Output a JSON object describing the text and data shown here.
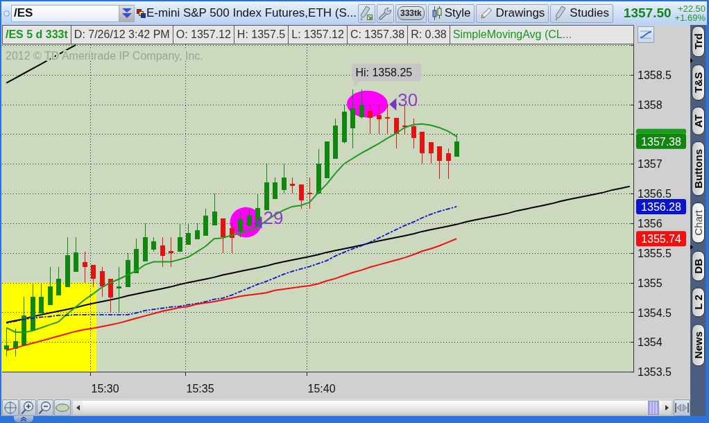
{
  "toolbar": {
    "symbol": "/ES",
    "description": "E-mini S&P 500 Index Futures,ETH (S...",
    "buttons": [
      {
        "kind": "pill",
        "label": "333tk"
      },
      {
        "kind": "candles",
        "label": "Style"
      },
      {
        "kind": "pencil",
        "label": "Drawings"
      },
      {
        "kind": "flask",
        "label": "Studies"
      }
    ],
    "last_price": "1357.50",
    "net_change": "+22.50",
    "percent_change": "+1.69%"
  },
  "info_bar": {
    "symbol": "/ES 5 d 333t",
    "fields": [
      "D: 7/26/12 3:42 PM",
      "O: 1357.12",
      "H: 1357.5",
      "L: 1357.12",
      "C: 1357.38",
      "R: 0.38"
    ],
    "study": "SimpleMovingAvg (CL..."
  },
  "chart": {
    "copyright": "2012 © TD Ameritrade IP Company, Inc.",
    "high_label": "Hi: 1358.25",
    "close_tag": "1357.38",
    "price_tags": [
      {
        "color": "#1e9a1e"
      },
      {
        "text": "1356.28",
        "color": "#0a14cc"
      },
      {
        "text": "1355.74",
        "color": "#f01010"
      }
    ],
    "chart_data": {
      "type": "candlestick",
      "categories": [
        null,
        null,
        null,
        null,
        null,
        null,
        null,
        null,
        null,
        null,
        null,
        "15:30",
        null,
        null,
        null,
        null,
        null,
        null,
        null,
        null,
        null,
        null,
        "15:35",
        null,
        null,
        null,
        null,
        null,
        null,
        null,
        null,
        null,
        null,
        null,
        null,
        null,
        "15:40",
        null,
        null,
        null,
        null,
        null,
        null,
        null,
        null,
        null,
        null,
        null,
        null,
        null,
        null,
        null,
        null,
        null,
        null,
        null,
        null,
        null,
        null,
        null,
        null,
        null,
        null,
        null,
        null,
        null,
        null,
        null,
        null,
        null,
        null,
        null,
        null
      ],
      "ohlc": [
        [
          1353.87,
          1354.24,
          1353.76,
          1353.94
        ],
        [
          1353.89,
          1354.22,
          1353.76,
          1354.02
        ],
        [
          1353.95,
          1354.76,
          1353.95,
          1354.45
        ],
        [
          1354.19,
          1355.0,
          1354.19,
          1354.76
        ],
        [
          1354.48,
          1355.0,
          1354.48,
          1354.76
        ],
        [
          1354.62,
          1355.26,
          1354.62,
          1354.94
        ],
        [
          1354.78,
          1355.26,
          1354.78,
          1355.07
        ],
        [
          1354.93,
          1355.76,
          1354.93,
          1355.46
        ],
        [
          1355.18,
          1355.76,
          1355.18,
          1355.51
        ],
        [
          1355.35,
          1355.52,
          1355.0,
          1355.26
        ],
        [
          1355.3,
          1355.3,
          1354.92,
          1355.07
        ],
        [
          1355.19,
          1355.26,
          1354.76,
          1354.94
        ],
        [
          1355.06,
          1355.07,
          1354.5,
          1354.75
        ],
        [
          1354.9,
          1355.26,
          1354.5,
          1354.94
        ],
        [
          1354.93,
          1355.5,
          1354.93,
          1355.38
        ],
        [
          1355.16,
          1355.74,
          1355.16,
          1355.57
        ],
        [
          1355.36,
          1356.0,
          1355.36,
          1355.76
        ],
        [
          1355.55,
          1355.76,
          1355.52,
          1355.69
        ],
        [
          1355.62,
          1355.76,
          1355.26,
          1355.45
        ],
        [
          1355.53,
          1355.76,
          1355.26,
          1355.5
        ],
        [
          1355.52,
          1356.0,
          1355.52,
          1355.76
        ],
        [
          1355.64,
          1356.0,
          1355.64,
          1355.83
        ],
        [
          1355.73,
          1356.0,
          1355.73,
          1355.88
        ],
        [
          1355.79,
          1356.25,
          1355.79,
          1356.13
        ],
        [
          1355.96,
          1356.5,
          1355.96,
          1356.2
        ],
        [
          1356.08,
          1356.08,
          1355.5,
          1355.76
        ],
        [
          1355.92,
          1356.0,
          1355.5,
          1355.75
        ],
        [
          1355.86,
          1356.19,
          1355.76,
          1356.07
        ],
        [
          1355.95,
          1356.25,
          1355.95,
          1356.13
        ],
        [
          1355.94,
          1356.5,
          1355.94,
          1356.26
        ],
        [
          1356.22,
          1357.0,
          1356.22,
          1356.69
        ],
        [
          1356.41,
          1356.77,
          1356.41,
          1356.69
        ],
        [
          1356.56,
          1357.0,
          1356.5,
          1356.77
        ],
        [
          1356.66,
          1356.77,
          1356.5,
          1356.63
        ],
        [
          1356.65,
          1356.65,
          1356.25,
          1356.38
        ],
        [
          1356.51,
          1356.77,
          1356.25,
          1356.49
        ],
        [
          1356.5,
          1357.25,
          1356.5,
          1357.0
        ],
        [
          1356.76,
          1357.38,
          1356.76,
          1357.38
        ],
        [
          1357.08,
          1357.76,
          1357.08,
          1357.64
        ],
        [
          1357.37,
          1358.0,
          1357.34,
          1357.88
        ],
        [
          1357.6,
          1358.25,
          1357.26,
          1357.94
        ],
        [
          1357.78,
          1358.25,
          1357.76,
          1358.0
        ],
        [
          1357.89,
          1358.0,
          1357.5,
          1357.77
        ],
        [
          1357.82,
          1358.0,
          1357.5,
          1357.75
        ],
        [
          1357.78,
          1358.0,
          1357.5,
          1357.76
        ],
        [
          1357.77,
          1357.77,
          1357.26,
          1357.5
        ],
        [
          1357.65,
          1358.0,
          1357.5,
          1357.63
        ],
        [
          1357.63,
          1357.76,
          1357.26,
          1357.44
        ],
        [
          1357.54,
          1357.54,
          1357.0,
          1357.18
        ],
        [
          1357.37,
          1357.37,
          1357.0,
          1357.18
        ],
        [
          1357.29,
          1357.29,
          1356.75,
          1357.05
        ],
        [
          1357.18,
          1357.26,
          1356.75,
          1357.05
        ],
        [
          1357.12,
          1357.5,
          1357.12,
          1357.38
        ],
        null,
        null,
        null,
        null,
        null,
        null,
        null,
        null,
        null,
        null,
        null,
        null,
        null,
        null,
        null,
        null,
        null,
        null,
        null,
        null
      ],
      "series": [
        {
          "type": "line",
          "color": "#1e9a1e",
          "values": [
            1354.24,
            1354.17,
            1354.16,
            1354.19,
            1354.24,
            1354.29,
            1354.34,
            1354.47,
            1354.59,
            1354.71,
            1354.81,
            1354.92,
            1355.0,
            1355.06,
            1355.13,
            1355.2,
            1355.3,
            1355.35,
            1355.35,
            1355.35,
            1355.39,
            1355.43,
            1355.52,
            1355.61,
            1355.74,
            1355.75,
            1355.8,
            1355.83,
            1355.88,
            1355.93,
            1356.04,
            1356.14,
            1356.22,
            1356.28,
            1356.3,
            1356.35,
            1356.51,
            1356.66,
            1356.84,
            1357.0,
            1357.09,
            1357.18,
            1357.26,
            1357.34,
            1357.43,
            1357.51,
            1357.61,
            1357.66,
            1357.67,
            1357.65,
            1357.61,
            1357.55,
            1357.46,
            null,
            null,
            null,
            null,
            null,
            null,
            null,
            null,
            null,
            null,
            null,
            null,
            null,
            null,
            null,
            null,
            null,
            null,
            null,
            null
          ]
        },
        {
          "type": "line",
          "color": "#0a14cc",
          "line_style": "dashed",
          "values": [
            1354.32,
            1354.35,
            1354.38,
            1354.4,
            1354.42,
            1354.43,
            1354.45,
            1354.45,
            1354.46,
            1354.46,
            1354.46,
            1354.46,
            1354.46,
            1354.46,
            1354.46,
            1354.49,
            1354.53,
            1354.55,
            1354.57,
            1354.59,
            1354.6,
            1354.63,
            1354.65,
            1354.68,
            1354.72,
            1354.74,
            1354.79,
            1354.85,
            1354.91,
            1354.97,
            1355.02,
            1355.08,
            1355.14,
            1355.19,
            1355.23,
            1355.27,
            1355.32,
            1355.37,
            1355.45,
            1355.51,
            1355.57,
            1355.62,
            1355.68,
            1355.75,
            1355.82,
            1355.89,
            1355.96,
            1356.02,
            1356.09,
            1356.15,
            1356.2,
            1356.24,
            1356.28,
            null,
            null,
            null,
            null,
            null,
            null,
            null,
            null,
            null,
            null,
            null,
            null,
            null,
            null,
            null,
            null,
            null,
            null,
            null,
            null
          ]
        },
        {
          "type": "line",
          "color": "#f01010",
          "values": [
            1353.86,
            1353.9,
            1353.94,
            1353.98,
            1354.02,
            1354.06,
            1354.1,
            1354.14,
            1354.18,
            1354.21,
            1354.23,
            1354.26,
            1354.29,
            1354.32,
            1354.36,
            1354.4,
            1354.44,
            1354.48,
            1354.52,
            1354.55,
            1354.58,
            1354.6,
            1354.64,
            1354.66,
            1354.68,
            1354.71,
            1354.74,
            1354.77,
            1354.79,
            1354.81,
            1354.83,
            1354.87,
            1354.89,
            1354.91,
            1354.93,
            1354.95,
            1354.98,
            1355.03,
            1355.07,
            1355.12,
            1355.17,
            1355.21,
            1355.26,
            1355.3,
            1355.34,
            1355.38,
            1355.42,
            1355.47,
            1355.53,
            1355.57,
            1355.62,
            1355.68,
            1355.74,
            null,
            null,
            null,
            null,
            null,
            null,
            null,
            null,
            null,
            null,
            null,
            null,
            null,
            null,
            null,
            null,
            null,
            null,
            null,
            null
          ]
        },
        {
          "type": "line",
          "color": "#000000",
          "values": [
            1354.33,
            1354.36,
            1354.39,
            1354.43,
            1354.46,
            1354.49,
            1354.52,
            1354.55,
            1354.58,
            1354.62,
            1354.65,
            1354.68,
            1354.71,
            1354.74,
            1354.78,
            1354.81,
            1354.84,
            1354.87,
            1354.9,
            1354.93,
            1354.97,
            1355.0,
            1355.03,
            1355.06,
            1355.09,
            1355.13,
            1355.16,
            1355.19,
            1355.22,
            1355.25,
            1355.28,
            1355.32,
            1355.35,
            1355.38,
            1355.41,
            1355.44,
            1355.47,
            1355.51,
            1355.54,
            1355.57,
            1355.6,
            1355.63,
            1355.67,
            1355.7,
            1355.73,
            1355.76,
            1355.79,
            1355.82,
            1355.86,
            1355.89,
            1355.92,
            1355.95,
            1355.98,
            1356.02,
            1356.05,
            1356.08,
            1356.11,
            1356.14,
            1356.17,
            1356.21,
            1356.24,
            1356.27,
            1356.3,
            1356.33,
            1356.37,
            1356.4,
            1356.43,
            1356.46,
            1356.49,
            1356.52,
            1356.56,
            1356.59,
            1356.62
          ]
        },
        {
          "type": "line",
          "color": "#000000",
          "values": [
            1358.36,
            1358.44,
            1358.52,
            1358.6,
            1358.68,
            1358.76,
            1358.84,
            1358.92,
            1359.0,
            null,
            null,
            null,
            null,
            null,
            null,
            null,
            null,
            null,
            null,
            null,
            null,
            null,
            null,
            null,
            null,
            null,
            null,
            null,
            null,
            null,
            null,
            null,
            null,
            null,
            null,
            null,
            null,
            null,
            null,
            null,
            null,
            null,
            null,
            null,
            null,
            null,
            null,
            null,
            null,
            null,
            null,
            null,
            null,
            null,
            null,
            null,
            null,
            null,
            null,
            null,
            null,
            null,
            null,
            null,
            null,
            null,
            null,
            null,
            null,
            null,
            null,
            null,
            null
          ]
        }
      ],
      "ylim": [
        1353.49,
        1359.01
      ],
      "yticks": [
        1353.5,
        1354,
        1354.5,
        1355,
        1355.5,
        1356,
        1356.5,
        1357,
        1358,
        1358.5
      ],
      "grid": true,
      "annotations": [
        "29",
        "30"
      ]
    }
  },
  "side_tab_groups": [
    {
      "tabs": [
        {
          "label": "Trd",
          "selected": false
        }
      ]
    },
    {
      "tabs": [
        {
          "label": "T&S",
          "selected": false
        },
        {
          "label": "AT",
          "selected": false
        },
        {
          "label": "Buttons",
          "selected": false
        },
        {
          "label": "Chart",
          "selected": true
        }
      ]
    },
    {
      "tabs": [
        {
          "label": "DB",
          "selected": false
        },
        {
          "label": "L 2",
          "selected": false
        },
        {
          "label": "News",
          "selected": false
        }
      ]
    }
  ]
}
